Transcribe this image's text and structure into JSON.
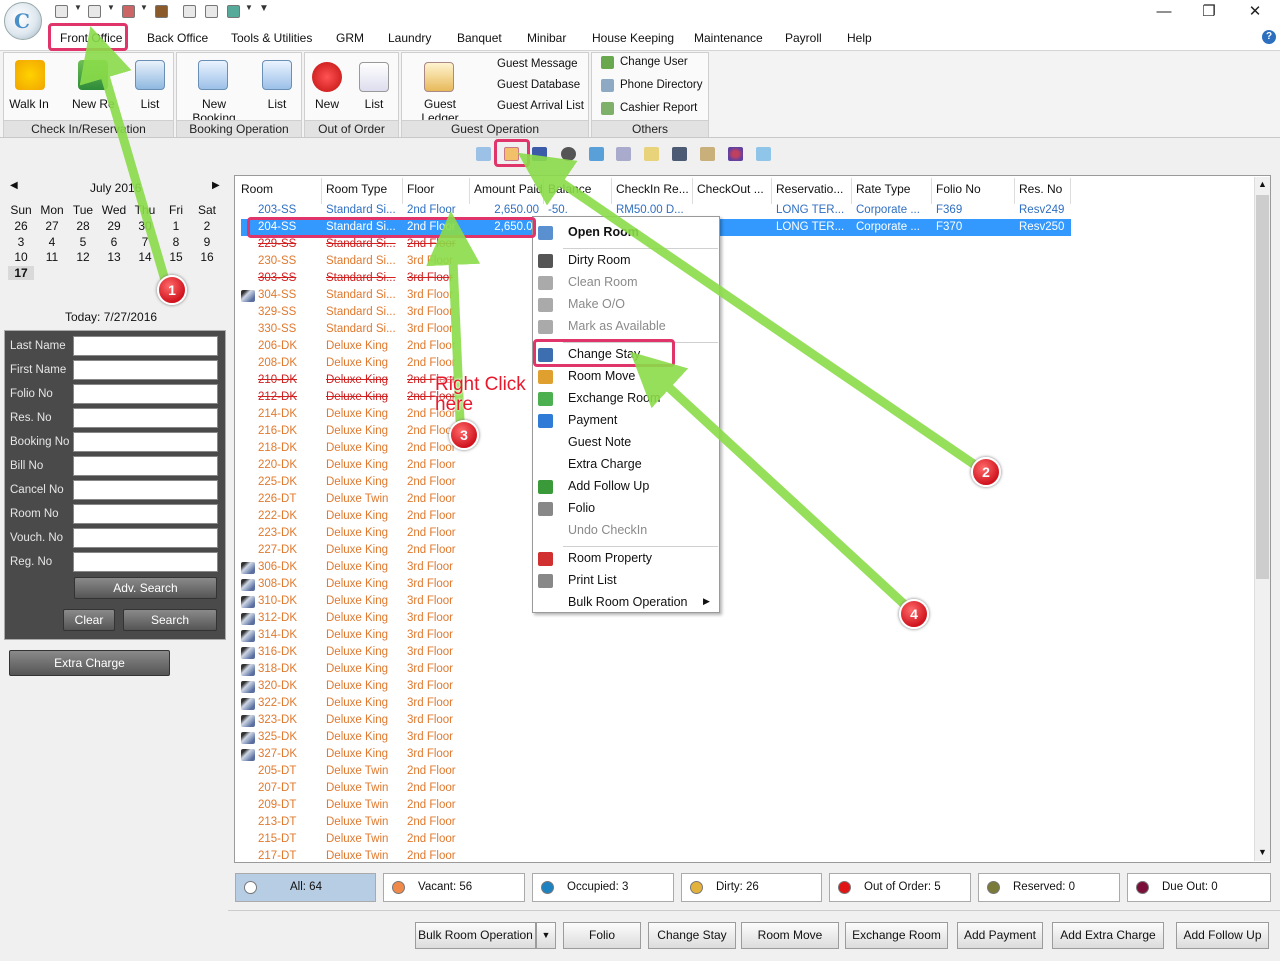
{
  "menu": {
    "items": [
      "Front Office",
      "Back Office",
      "Tools & Utilities",
      "GRM",
      "Laundry",
      "Banquet",
      "Minibar",
      "House Keeping",
      "Maintenance",
      "Payroll",
      "Help"
    ]
  },
  "ribbon": {
    "checkin": {
      "group": "Check In/Reservation",
      "walk_in": "Walk In",
      "new_res": "New Re",
      "list": "List"
    },
    "booking": {
      "group": "Booking Operation",
      "new_booking": "New Booking",
      "list": "List"
    },
    "ooo": {
      "group": "Out of Order Ro...",
      "new": "New",
      "list": "List"
    },
    "guest": {
      "group": "Guest Operation",
      "ledger": "Guest Ledger",
      "message": "Guest Message",
      "database": "Guest Database",
      "arrival": "Guest Arrival List"
    },
    "others": {
      "group": "Others",
      "change_user": "Change User",
      "phone": "Phone Directory",
      "cashier": "Cashier Report"
    }
  },
  "calendar": {
    "month": "July 2016",
    "days": [
      "Sun",
      "Mon",
      "Tue",
      "Wed",
      "Thu",
      "Fri",
      "Sat"
    ],
    "weeks": [
      [
        "26",
        "27",
        "28",
        "29",
        "30",
        "1",
        "2"
      ],
      [
        "3",
        "4",
        "5",
        "6",
        "7",
        "8",
        "9"
      ],
      [
        "10",
        "11",
        "12",
        "13",
        "14",
        "15",
        "16"
      ],
      [
        "17",
        "",
        "",
        "",
        "",
        "",
        ""
      ]
    ],
    "today": "Today: 7/27/2016"
  },
  "search": {
    "fields": [
      "Last Name",
      "First Name",
      "Folio No",
      "Res. No",
      "Booking No",
      "Bill No",
      "Cancel No",
      "Room No",
      "Vouch. No",
      "Reg. No"
    ],
    "adv": "Adv. Search",
    "clear": "Clear",
    "search": "Search",
    "extra": "Extra Charge"
  },
  "grid": {
    "headers": [
      "Room",
      "Room Type",
      "Floor",
      "Amount Paid",
      "Balance",
      "CheckIn Re...",
      "CheckOut ...",
      "Reservatio...",
      "Rate Type",
      "Folio No",
      "Res. No"
    ],
    "occupied": [
      {
        "room": "203-SS",
        "type": "Standard Si...",
        "floor": "2nd Floor",
        "paid": "2,650.00",
        "balance": "-50.",
        "checkin": "RM50.00 D...",
        "res": "LONG TER...",
        "rate": "Corporate ...",
        "folio": "F369",
        "resno": "Resv249"
      },
      {
        "room": "204-SS",
        "type": "Standard Si...",
        "floor": "2nd Floor",
        "paid": "2,650.00",
        "balance": "",
        "checkin": "",
        "res": "LONG TER...",
        "rate": "Corporate ...",
        "folio": "F370",
        "resno": "Resv250"
      }
    ],
    "rows": [
      {
        "room": "229-SS",
        "type": "Standard Si...",
        "floor": "2nd Floor",
        "s": "strike"
      },
      {
        "room": "230-SS",
        "type": "Standard Si...",
        "floor": "3rd Floor",
        "s": ""
      },
      {
        "room": "303-SS",
        "type": "Standard Si...",
        "floor": "3rd Floor",
        "s": "strike"
      },
      {
        "room": "304-SS",
        "type": "Standard Si...",
        "floor": "3rd Floor",
        "s": "icon"
      },
      {
        "room": "329-SS",
        "type": "Standard Si...",
        "floor": "3rd Floor",
        "s": ""
      },
      {
        "room": "330-SS",
        "type": "Standard Si...",
        "floor": "3rd Floor",
        "s": ""
      },
      {
        "room": "206-DK",
        "type": "Deluxe King",
        "floor": "2nd Floor",
        "s": ""
      },
      {
        "room": "208-DK",
        "type": "Deluxe King",
        "floor": "2nd Floor",
        "s": ""
      },
      {
        "room": "210-DK",
        "type": "Deluxe King",
        "floor": "2nd Floor",
        "s": "strike"
      },
      {
        "room": "212-DK",
        "type": "Deluxe King",
        "floor": "2nd Floor",
        "s": "strike"
      },
      {
        "room": "214-DK",
        "type": "Deluxe King",
        "floor": "2nd Floor",
        "s": ""
      },
      {
        "room": "216-DK",
        "type": "Deluxe King",
        "floor": "2nd Floor",
        "s": ""
      },
      {
        "room": "218-DK",
        "type": "Deluxe King",
        "floor": "2nd Floor",
        "s": ""
      },
      {
        "room": "220-DK",
        "type": "Deluxe King",
        "floor": "2nd Floor",
        "s": ""
      },
      {
        "room": "225-DK",
        "type": "Deluxe King",
        "floor": "2nd Floor",
        "s": ""
      },
      {
        "room": "226-DT",
        "type": "Deluxe Twin",
        "floor": "2nd Floor",
        "s": ""
      },
      {
        "room": "222-DK",
        "type": "Deluxe King",
        "floor": "2nd Floor",
        "s": ""
      },
      {
        "room": "223-DK",
        "type": "Deluxe King",
        "floor": "2nd Floor",
        "s": ""
      },
      {
        "room": "227-DK",
        "type": "Deluxe King",
        "floor": "2nd Floor",
        "s": ""
      },
      {
        "room": "306-DK",
        "type": "Deluxe King",
        "floor": "3rd Floor",
        "s": "icon"
      },
      {
        "room": "308-DK",
        "type": "Deluxe King",
        "floor": "3rd Floor",
        "s": "icon"
      },
      {
        "room": "310-DK",
        "type": "Deluxe King",
        "floor": "3rd Floor",
        "s": "icon"
      },
      {
        "room": "312-DK",
        "type": "Deluxe King",
        "floor": "3rd Floor",
        "s": "icon"
      },
      {
        "room": "314-DK",
        "type": "Deluxe King",
        "floor": "3rd Floor",
        "s": "icon"
      },
      {
        "room": "316-DK",
        "type": "Deluxe King",
        "floor": "3rd Floor",
        "s": "icon"
      },
      {
        "room": "318-DK",
        "type": "Deluxe King",
        "floor": "3rd Floor",
        "s": "icon"
      },
      {
        "room": "320-DK",
        "type": "Deluxe King",
        "floor": "3rd Floor",
        "s": "icon"
      },
      {
        "room": "322-DK",
        "type": "Deluxe King",
        "floor": "3rd Floor",
        "s": "icon"
      },
      {
        "room": "323-DK",
        "type": "Deluxe King",
        "floor": "3rd Floor",
        "s": "icon"
      },
      {
        "room": "325-DK",
        "type": "Deluxe King",
        "floor": "3rd Floor",
        "s": "icon"
      },
      {
        "room": "327-DK",
        "type": "Deluxe King",
        "floor": "3rd Floor",
        "s": "icon"
      },
      {
        "room": "205-DT",
        "type": "Deluxe Twin",
        "floor": "2nd Floor",
        "s": ""
      },
      {
        "room": "207-DT",
        "type": "Deluxe Twin",
        "floor": "2nd Floor",
        "s": ""
      },
      {
        "room": "209-DT",
        "type": "Deluxe Twin",
        "floor": "2nd Floor",
        "s": ""
      },
      {
        "room": "213-DT",
        "type": "Deluxe Twin",
        "floor": "2nd Floor",
        "s": ""
      },
      {
        "room": "215-DT",
        "type": "Deluxe Twin",
        "floor": "2nd Floor",
        "s": ""
      },
      {
        "room": "217-DT",
        "type": "Deluxe Twin",
        "floor": "2nd Floor",
        "s": ""
      }
    ]
  },
  "context_menu": [
    {
      "label": "Open Room",
      "bold": true,
      "dis": false
    },
    {
      "sep": true
    },
    {
      "label": "Dirty Room",
      "dis": false
    },
    {
      "label": "Clean Room",
      "dis": true
    },
    {
      "label": "Make O/O",
      "dis": true
    },
    {
      "label": "Mark as Available",
      "dis": true
    },
    {
      "sep": true
    },
    {
      "label": "Change Stay",
      "dis": false
    },
    {
      "label": "Room Move",
      "dis": false
    },
    {
      "label": "Exchange Room",
      "dis": false
    },
    {
      "label": "Payment",
      "dis": false
    },
    {
      "label": "Guest Note",
      "dis": false
    },
    {
      "label": "Extra Charge",
      "dis": false
    },
    {
      "label": "Add Follow Up",
      "dis": false
    },
    {
      "label": "Folio",
      "dis": false
    },
    {
      "label": "Undo CheckIn",
      "dis": true
    },
    {
      "sep": true
    },
    {
      "label": "Room Property",
      "dis": false
    },
    {
      "label": "Print List",
      "dis": false
    },
    {
      "label": "Bulk Room Operation",
      "dis": false,
      "sub": true
    }
  ],
  "status": [
    {
      "label": "All: 64",
      "color": "#ffffff"
    },
    {
      "label": "Vacant: 56",
      "color": "#f08a4b"
    },
    {
      "label": "Occupied: 3",
      "color": "#1f82c0"
    },
    {
      "label": "Dirty: 26",
      "color": "#e3b23c"
    },
    {
      "label": "Out of Order: 5",
      "color": "#e01515"
    },
    {
      "label": "Reserved: 0",
      "color": "#7a7a3a"
    },
    {
      "label": "Due Out: 0",
      "color": "#7a0f3a"
    }
  ],
  "bottom": [
    "Bulk Room Operation",
    "Folio",
    "Change Stay",
    "Room Move",
    "Exchange Room",
    "Add Payment",
    "Add Extra Charge",
    "Add Follow Up"
  ],
  "annotation": {
    "line1": "Right Click",
    "line2": "here",
    "badges": [
      "1",
      "2",
      "3",
      "4"
    ]
  },
  "colors": {
    "room_text": "#e0792e",
    "selected": "#3399ff",
    "normal_text": "#2f6fc1"
  }
}
